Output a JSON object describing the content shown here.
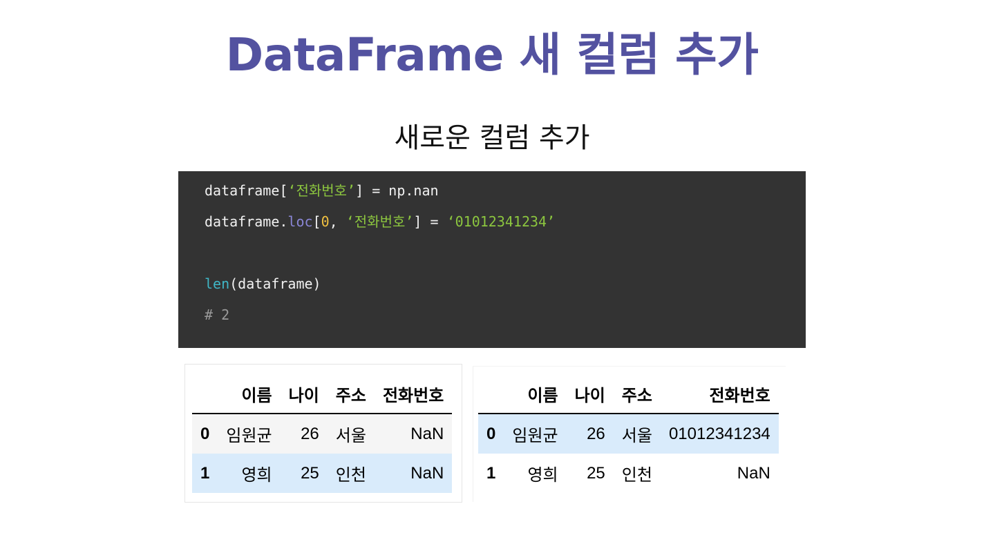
{
  "slide": {
    "title": "DataFrame 새 컬럼 추가",
    "subtitle": "새로운 컬럼 추가"
  },
  "code": {
    "line1": {
      "a": "dataframe[",
      "s": "‘전화번호’",
      "b": "] = np.nan"
    },
    "line2": {
      "a": "dataframe.",
      "attr": "loc",
      "b": "[",
      "n": "0",
      "c": ", ",
      "s1": "‘전화번호’",
      "d": "] = ",
      "s2": "‘01012341234’"
    },
    "line4": {
      "fn": "len",
      "a": "(dataframe)"
    },
    "line5": {
      "cmt": "# 2"
    }
  },
  "tables": {
    "left": {
      "headers": [
        "",
        "이름",
        "나이",
        "주소",
        "전화번호"
      ],
      "rows": [
        [
          "0",
          "임원균",
          "26",
          "서울",
          "NaN"
        ],
        [
          "1",
          "영희",
          "25",
          "인천",
          "NaN"
        ]
      ]
    },
    "right": {
      "headers": [
        "",
        "이름",
        "나이",
        "주소",
        "전화번호"
      ],
      "rows": [
        [
          "0",
          "임원균",
          "26",
          "서울",
          "01012341234"
        ],
        [
          "1",
          "영희",
          "25",
          "인천",
          "NaN"
        ]
      ]
    }
  }
}
